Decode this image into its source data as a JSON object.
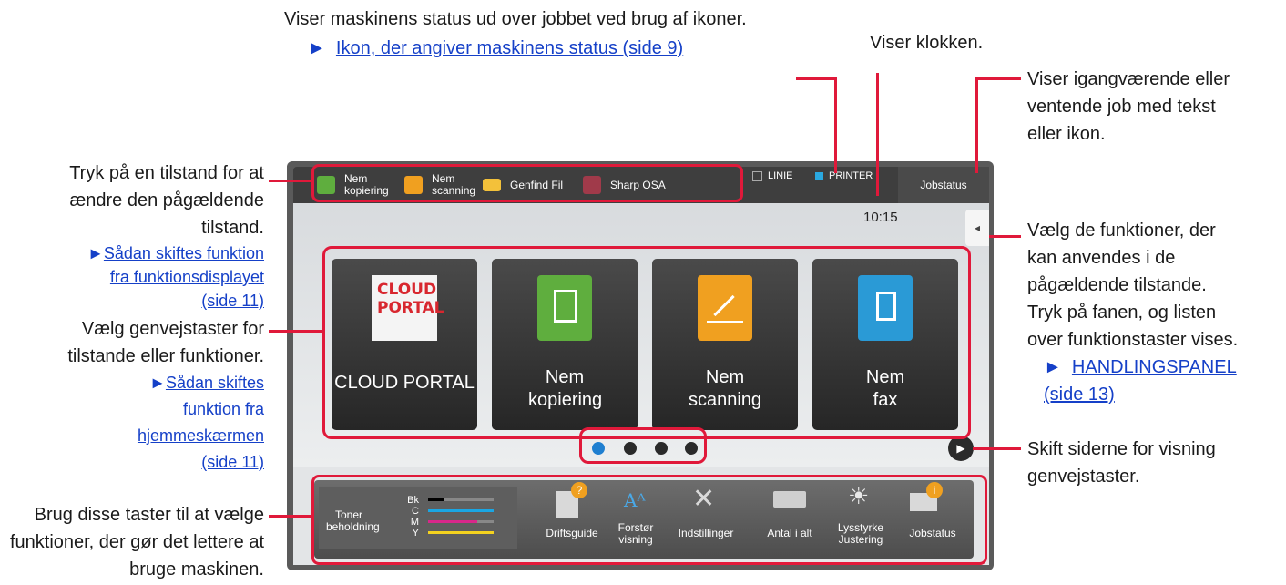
{
  "callouts": {
    "status": {
      "text": "Viser maskinens status ud over jobbet ved brug af ikoner.",
      "link": "Ikon, der angiver maskinens status (side 9)"
    },
    "clock": {
      "text": "Viser klokken."
    },
    "jobs": {
      "text": "Viser igangværende eller ventende job med tekst eller ikon."
    },
    "mode": {
      "text": "Tryk på en tilstand for at ændre den pågældende tilstand.",
      "link": "Sådan skiftes funktion fra funktionsdisplayet (side 11)"
    },
    "shortcuts": {
      "text": "Vælg genvejstaster for tilstande eller funktioner.",
      "link": "Sådan skiftes funktion fra hjemmeskærmen (side 11)"
    },
    "bottom": {
      "text": "Brug disse taster til at vælge funktioner, der gør det lettere at bruge maskinen."
    },
    "panel": {
      "text": "Vælg de funktioner, der kan anvendes i de pågældende tilstande. Tryk på fanen, og listen over funktionstaster vises.",
      "link": "HANDLINGSPANEL (side 13)"
    },
    "pages": {
      "text": "Skift siderne for visning genvejstaster."
    }
  },
  "topbar": {
    "modes": [
      "Nem kopiering",
      "Nem scanning",
      "Genfind Fil",
      "Sharp OSA"
    ],
    "indicators": [
      "LINIE",
      "PRINTER"
    ],
    "jobstatus": "Jobstatus",
    "clock": "10:15"
  },
  "tiles": [
    "CLOUD PORTAL",
    "Nem kopiering",
    "Nem scanning",
    "Nem fax"
  ],
  "cloud_logo": [
    "CLOUD",
    "PORTAL"
  ],
  "pager": {
    "pages": 4,
    "current": 1
  },
  "bottombar": {
    "toner_label": "Toner beholdning",
    "toner_colors": [
      "Bk",
      "C",
      "M",
      "Y"
    ],
    "keys": [
      "Driftsguide",
      "Forstør visning",
      "Indstillinger",
      "Antal i alt",
      "Lysstyrke Justering",
      "Jobstatus"
    ]
  },
  "colors": {
    "callout_red": "#e0193a",
    "link_blue": "#1540c8"
  }
}
